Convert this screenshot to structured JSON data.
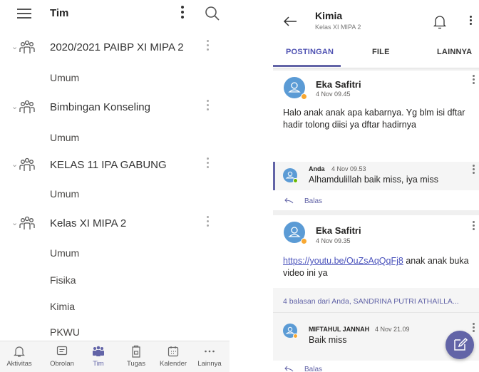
{
  "left": {
    "header": {
      "title": "Tim"
    },
    "teams": [
      {
        "name": "2020/2021 PAIBP XI MIPA 2",
        "channels": [
          "Umum"
        ]
      },
      {
        "name": "Bimbingan Konseling",
        "channels": [
          "Umum"
        ]
      },
      {
        "name": "KELAS 11 IPA GABUNG",
        "channels": [
          "Umum"
        ]
      },
      {
        "name": "Kelas XI MIPA 2",
        "channels": [
          "Umum",
          "Fisika",
          "Kimia",
          "PKWU"
        ]
      }
    ],
    "nav": [
      {
        "label": "Aktivitas",
        "icon": "bell-icon"
      },
      {
        "label": "Obrolan",
        "icon": "chat-icon"
      },
      {
        "label": "Tim",
        "icon": "teams-icon"
      },
      {
        "label": "Tugas",
        "icon": "assignments-icon"
      },
      {
        "label": "Kalender",
        "icon": "calendar-icon"
      },
      {
        "label": "Lainnya",
        "icon": "more-icon"
      }
    ]
  },
  "right": {
    "header": {
      "title": "Kimia",
      "subtitle": "Kelas XI MIPA 2"
    },
    "tabs": [
      "POSTINGAN",
      "FILE",
      "LAINNYA"
    ],
    "posts": [
      {
        "author": "Eka Safitri",
        "time": "4 Nov 09.45",
        "body": "Halo anak anak apa kabarnya. Yg blm isi dftar hadir tolong diisi ya dftar hadirnya",
        "reply": {
          "author": "Anda",
          "time": "4 Nov 09.53",
          "body": "Alhamdulillah baik miss, iya miss"
        },
        "reply_label": "Balas"
      },
      {
        "author": "Eka Safitri",
        "time": "4 Nov 09.35",
        "link": "https://youtu.be/OuZsAqQqFj8",
        "body_after_link": " anak anak buka video ini ya",
        "summary": "4 balasan dari Anda, SANDRINA PUTRI  ATHAILLA...",
        "reply": {
          "author": "MIFTAHUL JANNAH",
          "time": "4 Nov 21.09",
          "body": "Baik miss"
        },
        "reply_label": "Balas"
      }
    ]
  },
  "colors": {
    "accent": "#6264a7",
    "avatar": "#5b9bd5",
    "away": "#f8a832",
    "available": "#6bb700"
  }
}
